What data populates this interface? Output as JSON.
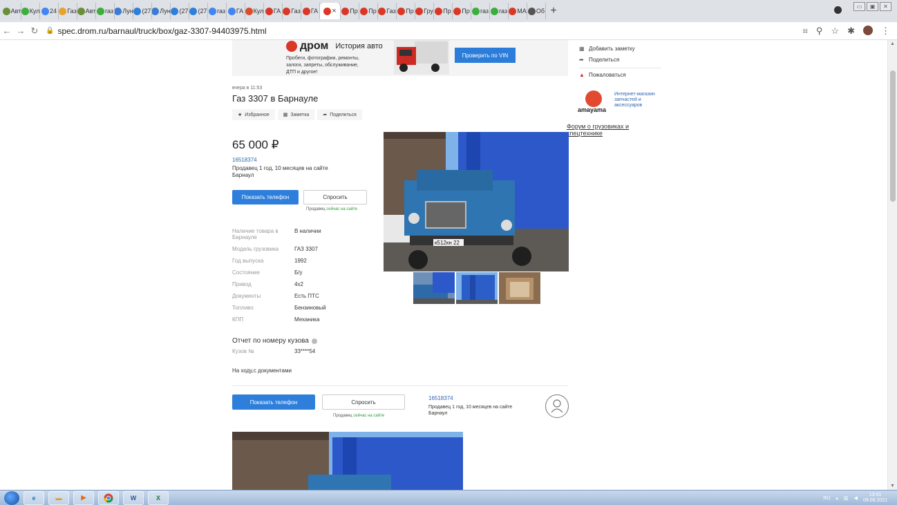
{
  "browser": {
    "tabs": [
      {
        "label": "Авт",
        "color": "#6a8f3a"
      },
      {
        "label": "Кул",
        "color": "#3cae3c"
      },
      {
        "label": "24",
        "color": "#4285f4"
      },
      {
        "label": "Газ",
        "color": "#e8a230"
      },
      {
        "label": "Авт",
        "color": "#6a8f3a"
      },
      {
        "label": "газ",
        "color": "#3cae3c"
      },
      {
        "label": "Лун",
        "color": "#3a7bd5"
      },
      {
        "label": "(27",
        "color": "#2e7fdb"
      },
      {
        "label": "Лун",
        "color": "#3a7bd5"
      },
      {
        "label": "(27",
        "color": "#2e7fdb"
      },
      {
        "label": "(27",
        "color": "#2e7fdb"
      },
      {
        "label": "газ",
        "color": "#4285f4"
      },
      {
        "label": "ГА",
        "color": "#4285f4"
      },
      {
        "label": "Кул",
        "color": "#d94d2b"
      },
      {
        "label": "ГА",
        "color": "#db3727"
      },
      {
        "label": "Газ",
        "color": "#db3727"
      },
      {
        "label": "ГА",
        "color": "#db3727"
      },
      {
        "label": "",
        "color": "#db3727",
        "active": true
      },
      {
        "label": "Пр",
        "color": "#db3727"
      },
      {
        "label": "Пр",
        "color": "#db3727"
      },
      {
        "label": "Газ",
        "color": "#db3727"
      },
      {
        "label": "Пр",
        "color": "#db3727"
      },
      {
        "label": "Гру",
        "color": "#db3727"
      },
      {
        "label": "Пр",
        "color": "#db3727"
      },
      {
        "label": "Пр",
        "color": "#db3727"
      },
      {
        "label": "газ",
        "color": "#3cae3c"
      },
      {
        "label": "газ",
        "color": "#3cae3c"
      },
      {
        "label": "МА",
        "color": "#db3727"
      },
      {
        "label": "Об",
        "color": "#555555"
      }
    ],
    "url": "spec.drom.ru/barnaul/truck/box/gaz-3307-94403975.html"
  },
  "banner": {
    "brand": "дром",
    "subtitle": "История авто",
    "text": "Пробеги, фотографии, ремонты, залоги, запреты, обслуживание, ДТП и другое!",
    "vin_button": "Проверить по VIN"
  },
  "sidebar": {
    "add_note": "Добавить заметку",
    "share": "Поделиться",
    "complain": "Пожаловаться",
    "amayama_name": "amayama",
    "amayama_desc": "Интернет-магазин запчастей и аксессуаров",
    "forum_link": "Форум о грузовиках и спецтехнике"
  },
  "listing": {
    "date": "вчера в 11:53",
    "title": "Газ 3307 в Барнауле",
    "actions": {
      "favorite": "Избранное",
      "note": "Заметка",
      "share": "Поделиться"
    },
    "price": "65 000 ₽",
    "seller_id": "16518374",
    "seller_since": "Продавец 1 год, 10 месяцев на сайте",
    "city": "Барнаул",
    "phone_button": "Показать телефон",
    "ask_button": "Спросить",
    "online_prefix": "Продавец",
    "online_status": "сейчас на сайте",
    "specs": [
      {
        "k": "Наличие товара в Барнауле",
        "v": "В наличии"
      },
      {
        "k": "Модель грузовика",
        "v": "ГАЗ 3307"
      },
      {
        "k": "Год выпуска",
        "v": "1992"
      },
      {
        "k": "Состояние",
        "v": "Б/у"
      },
      {
        "k": "Привод",
        "v": "4x2"
      },
      {
        "k": "Документы",
        "v": "Есть ПТС"
      },
      {
        "k": "Топливо",
        "v": "Бензиновый"
      },
      {
        "k": "КПП",
        "v": "Механика"
      }
    ],
    "report_title": "Отчет по номеру кузова",
    "body_label": "Кузов №",
    "body_value": "33****54",
    "description": "На ходу,с документами",
    "plate": "к512кн 22"
  },
  "taskbar": {
    "lang": "RU",
    "time": "13:41",
    "date": "09.08.2021",
    "apps": [
      "IE",
      "Folder",
      "Player",
      "Chrome",
      "W",
      "X"
    ]
  }
}
